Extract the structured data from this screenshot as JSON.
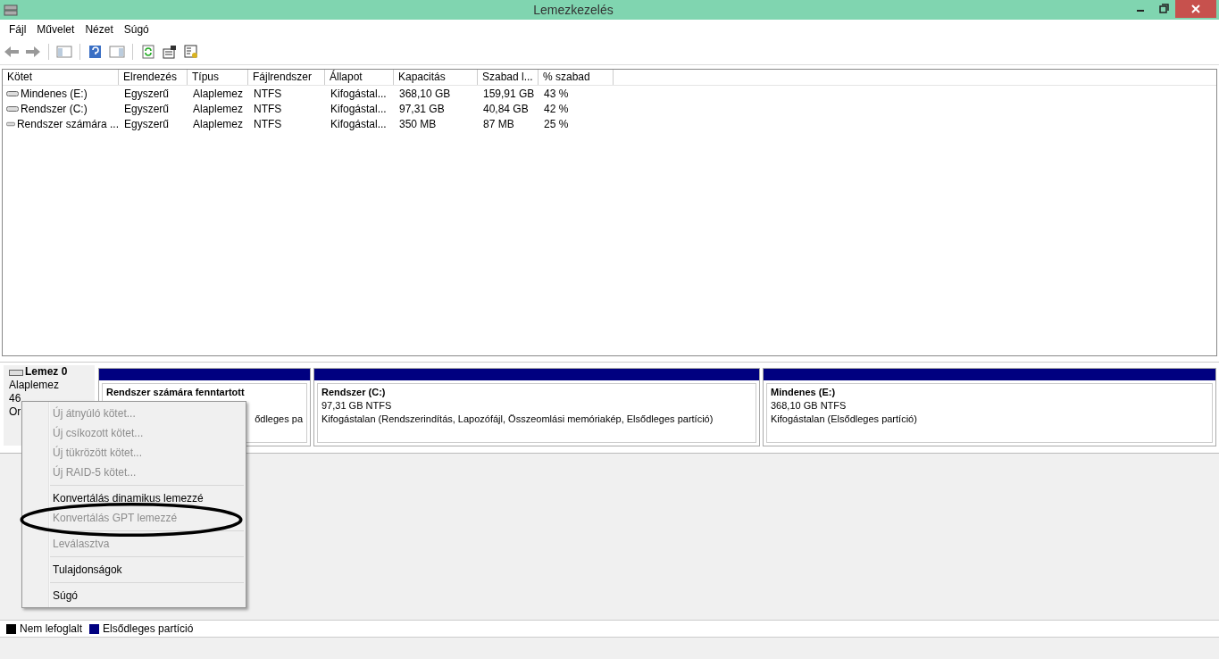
{
  "window": {
    "title": "Lemezkezelés"
  },
  "menu": [
    "Fájl",
    "Művelet",
    "Nézet",
    "Súgó"
  ],
  "table": {
    "columns": [
      "Kötet",
      "Elrendezés",
      "Típus",
      "Fájlrendszer",
      "Állapot",
      "Kapacitás",
      "Szabad l...",
      "% szabad"
    ],
    "rows": [
      [
        "Mindenes (E:)",
        "Egyszerű",
        "Alaplemez",
        "NTFS",
        "Kifogástal...",
        "368,10 GB",
        "159,91 GB",
        "43 %"
      ],
      [
        "Rendszer (C:)",
        "Egyszerű",
        "Alaplemez",
        "NTFS",
        "Kifogástal...",
        "97,31 GB",
        "40,84 GB",
        "42 %"
      ],
      [
        "Rendszer számára ...",
        "Egyszerű",
        "Alaplemez",
        "NTFS",
        "Kifogástal...",
        "350 MB",
        "87 MB",
        "25 %"
      ]
    ]
  },
  "disk": {
    "name": "Lemez 0",
    "type": "Alaplemez",
    "size": "46",
    "status": "Or",
    "partitions": [
      {
        "name": "Rendszer számára fenntartott",
        "lines": [
          "ődleges pa"
        ],
        "color": "#000080"
      },
      {
        "name": "Rendszer  (C:)",
        "lines": [
          "97,31 GB NTFS",
          "Kifogástalan (Rendszerindítás, Lapozófájl, Összeomlási memóriakép, Elsődleges partíció)"
        ],
        "color": "#000080"
      },
      {
        "name": "Mindenes  (E:)",
        "lines": [
          "368,10 GB NTFS",
          "Kifogástalan (Elsődleges partíció)"
        ],
        "color": "#000080"
      }
    ]
  },
  "context_menu": [
    {
      "label": "Új átnyúló kötet...",
      "disabled": true
    },
    {
      "label": "Új csíkozott kötet...",
      "disabled": true
    },
    {
      "label": "Új tükrözött kötet...",
      "disabled": true
    },
    {
      "label": "Új RAID-5 kötet...",
      "disabled": true,
      "separator_after": true
    },
    {
      "label": "Konvertálás dinamikus lemezzé",
      "disabled": false
    },
    {
      "label": "Konvertálás GPT lemezzé",
      "disabled": true,
      "separator_after": true
    },
    {
      "label": "Leválasztva",
      "disabled": true,
      "separator_after": true
    },
    {
      "label": "Tulajdonságok",
      "disabled": false,
      "separator_after": true
    },
    {
      "label": "Súgó",
      "disabled": false
    }
  ],
  "legend": [
    {
      "label": "Nem lefoglalt",
      "color": "#000000"
    },
    {
      "label": "Elsődleges partíció",
      "color": "#000080"
    }
  ]
}
